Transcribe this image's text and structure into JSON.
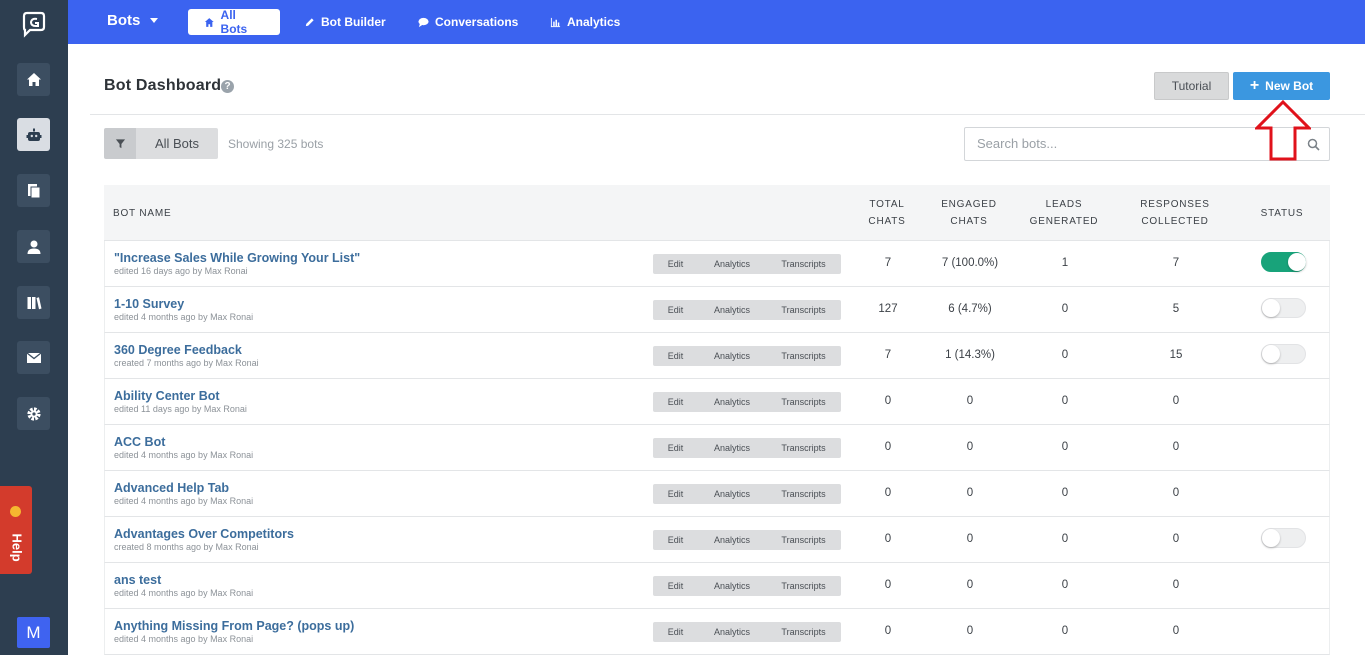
{
  "topbar": {
    "bots_menu": "Bots",
    "tabs": [
      {
        "label": "All Bots",
        "icon": "home-icon",
        "active": true
      },
      {
        "label": "Bot Builder",
        "icon": "pencil-icon",
        "active": false
      },
      {
        "label": "Conversations",
        "icon": "chat-bubble-icon",
        "active": false
      },
      {
        "label": "Analytics",
        "icon": "bar-chart-icon",
        "active": false
      }
    ]
  },
  "sidebar": {
    "items": [
      {
        "icon": "home-icon",
        "active": false
      },
      {
        "icon": "robot-icon",
        "active": true
      },
      {
        "icon": "documents-icon",
        "active": false
      },
      {
        "icon": "user-icon",
        "active": false
      },
      {
        "icon": "books-icon",
        "active": false
      },
      {
        "icon": "envelope-icon",
        "active": false
      },
      {
        "icon": "gear-icon",
        "active": false
      }
    ],
    "help_label": "Help",
    "avatar_initial": "M"
  },
  "header": {
    "title": "Bot Dashboard",
    "help_glyph": "?",
    "tutorial_label": "Tutorial",
    "new_bot_label": "New Bot"
  },
  "filter": {
    "all_bots_label": "All Bots",
    "showing_text": "Showing 325 bots",
    "search_placeholder": "Search bots..."
  },
  "table": {
    "columns": {
      "bot_name": "BOT NAME",
      "total_chats": [
        "TOTAL",
        "CHATS"
      ],
      "engaged_chats": [
        "ENGAGED",
        "CHATS"
      ],
      "leads_generated": [
        "LEADS",
        "GENERATED"
      ],
      "responses_collected": [
        "RESPONSES",
        "COLLECTED"
      ],
      "status": "STATUS"
    },
    "action_labels": {
      "edit": "Edit",
      "analytics": "Analytics",
      "transcripts": "Transcripts"
    },
    "rows": [
      {
        "name": "\"Increase Sales While Growing Your List\"",
        "meta": "edited 16 days ago by Max Ronai",
        "total": "7",
        "engaged": "7 (100.0%)",
        "leads": "1",
        "responses": "7",
        "status": "on"
      },
      {
        "name": "1-10 Survey",
        "meta": "edited 4 months ago by Max Ronai",
        "total": "127",
        "engaged": "6 (4.7%)",
        "leads": "0",
        "responses": "5",
        "status": "off"
      },
      {
        "name": "360 Degree Feedback",
        "meta": "created 7 months ago by Max Ronai",
        "total": "7",
        "engaged": "1 (14.3%)",
        "leads": "0",
        "responses": "15",
        "status": "off"
      },
      {
        "name": "Ability Center Bot",
        "meta": "edited 11 days ago by Max Ronai",
        "total": "0",
        "engaged": "0",
        "leads": "0",
        "responses": "0",
        "status": "none"
      },
      {
        "name": "ACC Bot",
        "meta": "edited 4 months ago by Max Ronai",
        "total": "0",
        "engaged": "0",
        "leads": "0",
        "responses": "0",
        "status": "none"
      },
      {
        "name": "Advanced Help Tab",
        "meta": "edited 4 months ago by Max Ronai",
        "total": "0",
        "engaged": "0",
        "leads": "0",
        "responses": "0",
        "status": "none"
      },
      {
        "name": "Advantages Over Competitors",
        "meta": "created 8 months ago by Max Ronai",
        "total": "0",
        "engaged": "0",
        "leads": "0",
        "responses": "0",
        "status": "off"
      },
      {
        "name": "ans test",
        "meta": "edited 4 months ago by Max Ronai",
        "total": "0",
        "engaged": "0",
        "leads": "0",
        "responses": "0",
        "status": "none"
      },
      {
        "name": "Anything Missing From Page? (pops up)",
        "meta": "edited 4 months ago by Max Ronai",
        "total": "0",
        "engaged": "0",
        "leads": "0",
        "responses": "0",
        "status": "none"
      }
    ]
  },
  "colors": {
    "topbar": "#3b63f0",
    "sidebar": "#2d3e50",
    "new_bot_button": "#3b97e0",
    "toggle_on": "#18a37a",
    "annotation_arrow": "#e0121b"
  }
}
